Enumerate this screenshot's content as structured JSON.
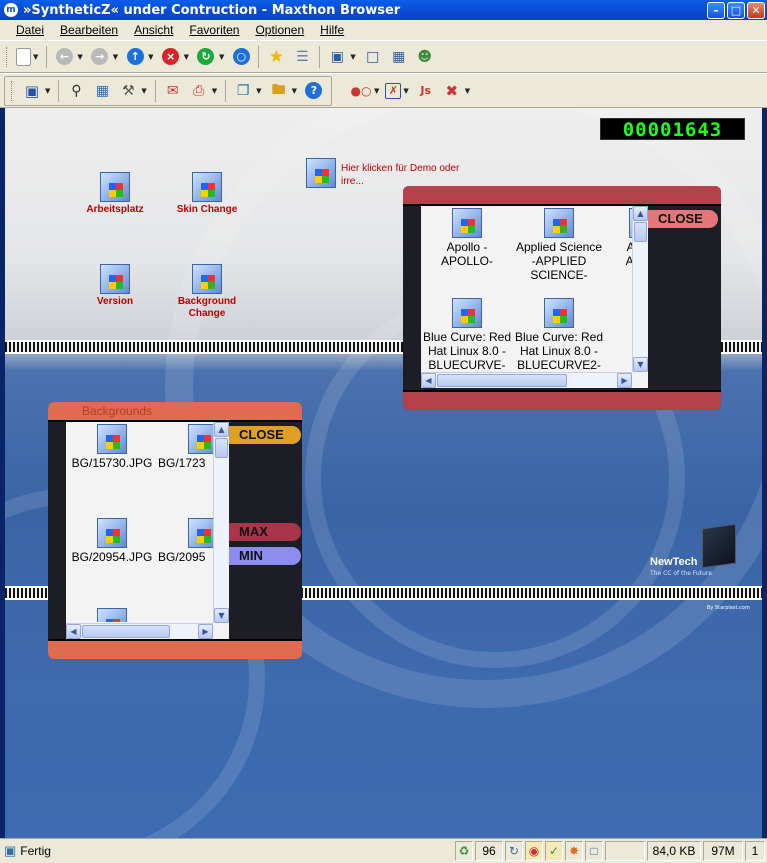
{
  "window": {
    "title": "»SyntheticZ« under Contruction - Maxthon Browser",
    "logo_letter": "m",
    "controls": [
      "minimize-icon",
      "maximize-icon",
      "close-icon"
    ]
  },
  "menu": {
    "items": [
      {
        "label": "Datei"
      },
      {
        "label": "Bearbeiten"
      },
      {
        "label": "Ansicht"
      },
      {
        "label": "Favoriten"
      },
      {
        "label": "Optionen"
      },
      {
        "label": "Hilfe"
      }
    ]
  },
  "toolbar1": {
    "icons": [
      "new-page-icon",
      "back-icon",
      "forward-icon",
      "upload-icon",
      "stop-icon",
      "refresh-icon",
      "home-icon",
      "favorites-icon",
      "groups-icon",
      "layout-icon",
      "window-icon",
      "view-icon",
      "users-icon"
    ]
  },
  "toolbar2": {
    "icons": [
      "save-icon",
      "search-icon",
      "screenshot-icon",
      "tools-icon",
      "mail-icon",
      "print-icon",
      "copy-icon",
      "open-folder-icon",
      "help-icon",
      "popup-icon",
      "block-icon",
      "javascript-icon",
      "close-all-icon"
    ]
  },
  "page": {
    "counter": "00001643",
    "desktop_icons": [
      {
        "label": "Arbeitsplatz"
      },
      {
        "label": "Skin Change"
      },
      {
        "label": "Version"
      },
      {
        "label": "Background Change"
      }
    ],
    "demo_link": "Hier klicken für Demo oder irre...",
    "skins_window": {
      "close_label": "CLOSE",
      "items": [
        {
          "label": "Apollo -APOLLO-"
        },
        {
          "label": "Applied Science -APPLIED SCIENCE-"
        },
        {
          "label": "A -AC"
        },
        {
          "label": "Blue Curve: Red Hat Linux 8.0 -BLUECURVE-"
        },
        {
          "label": "Blue Curve: Red Hat Linux 8.0 -BLUECURVE2-"
        }
      ]
    },
    "backgrounds_window": {
      "title": "Backgrounds",
      "close_label": "CLOSE",
      "max_label": "MAX",
      "min_label": "MIN",
      "items": [
        {
          "label": "BG/15730.JPG"
        },
        {
          "label": "BG/1723"
        },
        {
          "label": "BG/20954.JPG"
        },
        {
          "label": "BG/2095"
        }
      ]
    },
    "watermark_brand": "NewTech",
    "watermark_tagline": "The CC of the Future",
    "credit": "By Starplast.com"
  },
  "statusbar": {
    "text": "Fertig",
    "popup_count": "96",
    "size": "84,0 KB",
    "memory": "97M",
    "page": "1"
  },
  "colors": {
    "titlebar": "#0a4fd8",
    "window_chrome": "#ece9d8",
    "skin_window_bar": "#b5414a",
    "bg_window_bar": "#e06b4e",
    "close_pill": "#e0a024",
    "max_pill": "#a8354a",
    "min_pill": "#8d8df0",
    "counter_text": "#19ff19",
    "desktop_label": "#c00000"
  }
}
